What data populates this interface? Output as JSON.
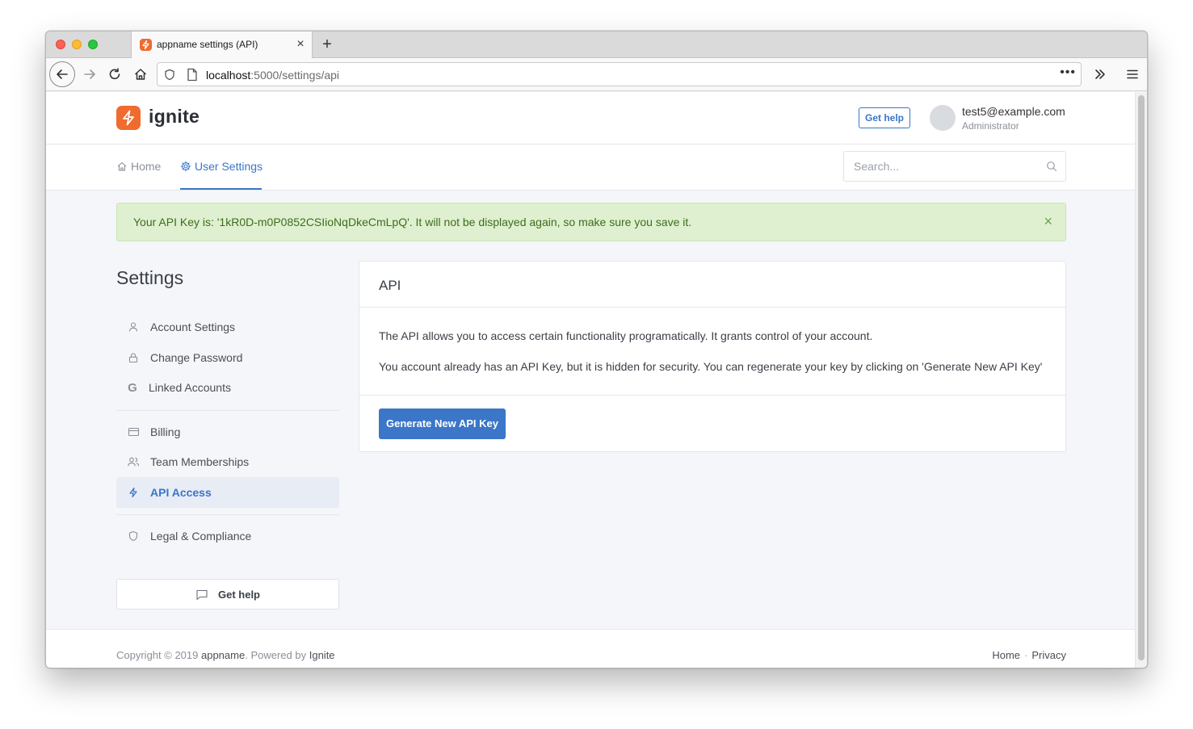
{
  "browser": {
    "tab_title": "appname settings (API)",
    "url_host": "localhost",
    "url_path": ":5000/settings/api"
  },
  "header": {
    "logo_text": "ignite",
    "help_label": "Get help",
    "user_email": "test5@example.com",
    "user_role": "Administrator"
  },
  "subnav": {
    "home_label": "Home",
    "settings_label": "User Settings",
    "search_placeholder": "Search..."
  },
  "alert": {
    "message": "Your API Key is: '1kR0D-m0P0852CSIioNqDkeCmLpQ'. It will not be displayed again, so make sure you save it."
  },
  "sidebar": {
    "title": "Settings",
    "items": [
      {
        "label": "Account Settings",
        "icon": "user-icon"
      },
      {
        "label": "Change Password",
        "icon": "lock-icon"
      },
      {
        "label": "Linked Accounts",
        "icon": "google-icon"
      },
      {
        "label": "Billing",
        "icon": "credit-card-icon"
      },
      {
        "label": "Team Memberships",
        "icon": "users-icon"
      },
      {
        "label": "API Access",
        "icon": "zap-icon"
      },
      {
        "label": "Legal & Compliance",
        "icon": "shield-icon"
      }
    ],
    "help_label": "Get help"
  },
  "card": {
    "title": "API",
    "p1": "The API allows you to access certain functionality programatically. It grants control of your account.",
    "p2": "You account already has an API Key, but it is hidden for security. You can regenerate your key by clicking on 'Generate New API Key'",
    "button_label": "Generate New API Key"
  },
  "footer": {
    "copyright_prefix": "Copyright © 2019",
    "appname": "appname",
    "powered_by": "Powered by",
    "brand": "Ignite",
    "link_home": "Home",
    "link_privacy": "Privacy"
  },
  "colors": {
    "accent": "#3b76c8",
    "brand": "#ef6b2e",
    "alert_bg": "#dff0d0",
    "alert_text": "#3c6d1d"
  }
}
